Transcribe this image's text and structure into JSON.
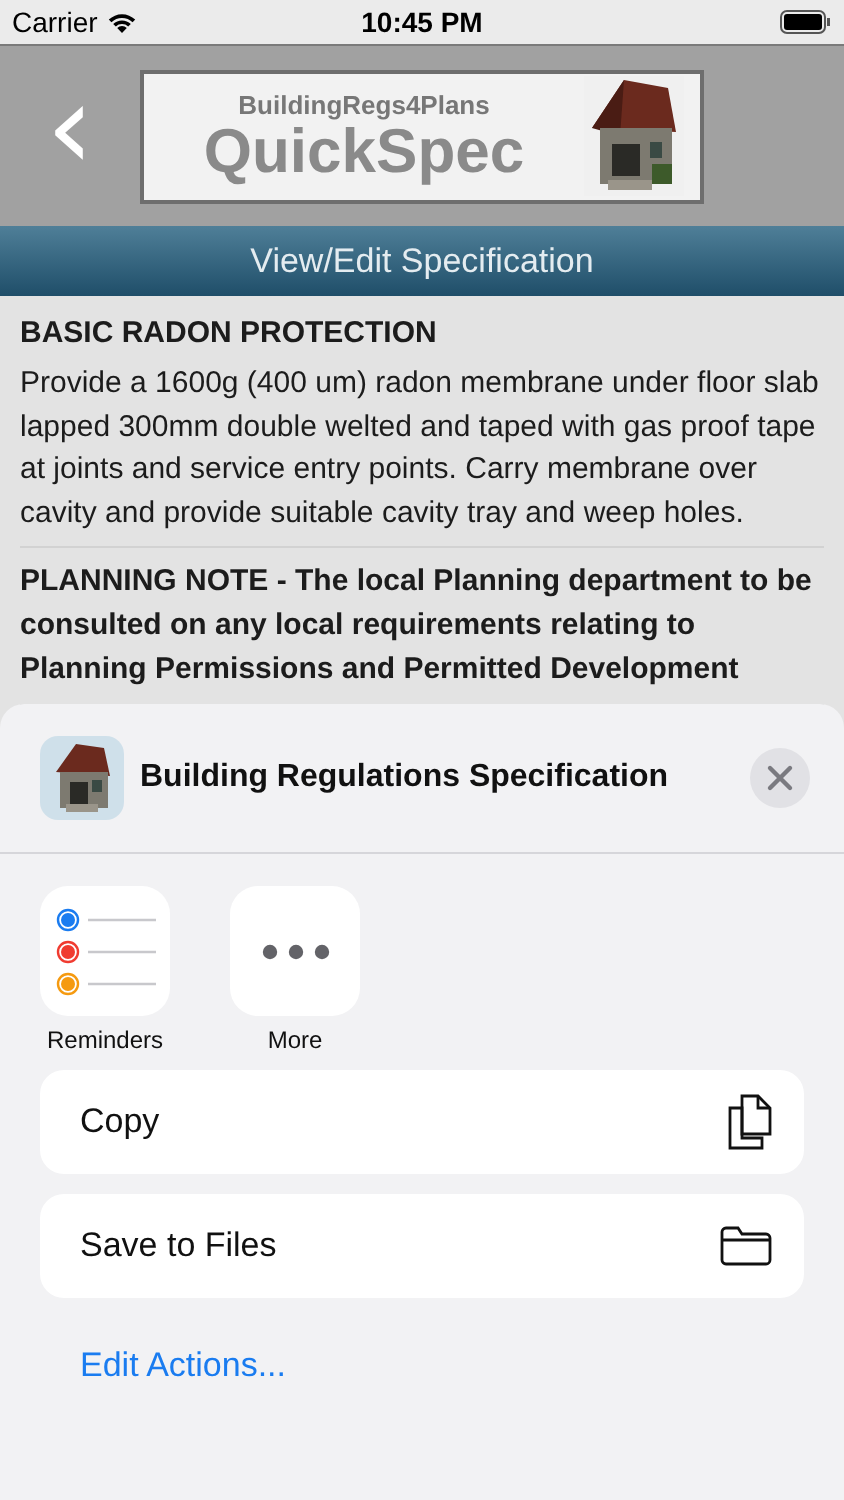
{
  "status_bar": {
    "carrier": "Carrier",
    "time": "10:45 PM"
  },
  "header": {
    "back_icon": "‹",
    "logo": {
      "tagline": "**B**uilding**R**egs**4P**lans",
      "name": "**Q**uick**S**pec",
      "kind": "picture"
    }
  },
  "title_bar": {
    "title": "View/Edit Specification"
  },
  "sections": [
    {
      "heading": "BASIC RADON PROTECTION",
      "body": "Provide a 1600g (400 um) radon membrane under floor slab lapped 300mm double welted and taped with gas proof tape at joints and service entry points. Carry membrane over cavity and provide suitable cavity tray and weep holes."
    },
    {
      "heading": "PLANNING NOTE - The local Planning department to be consulted on any local requirements relating to Planning Permissions and Permitted Development"
    }
  ],
  "share_sheet": {
    "title": "Building Regulations Specification",
    "apps": [
      {
        "label": "Reminders",
        "kind": "reminders"
      },
      {
        "label": "More",
        "kind": "more"
      }
    ],
    "actions": [
      {
        "label": "Copy",
        "kind": "copy"
      },
      {
        "label": "Save to Files",
        "kind": "folder"
      }
    ],
    "edit_actions": "Edit Actions..."
  }
}
